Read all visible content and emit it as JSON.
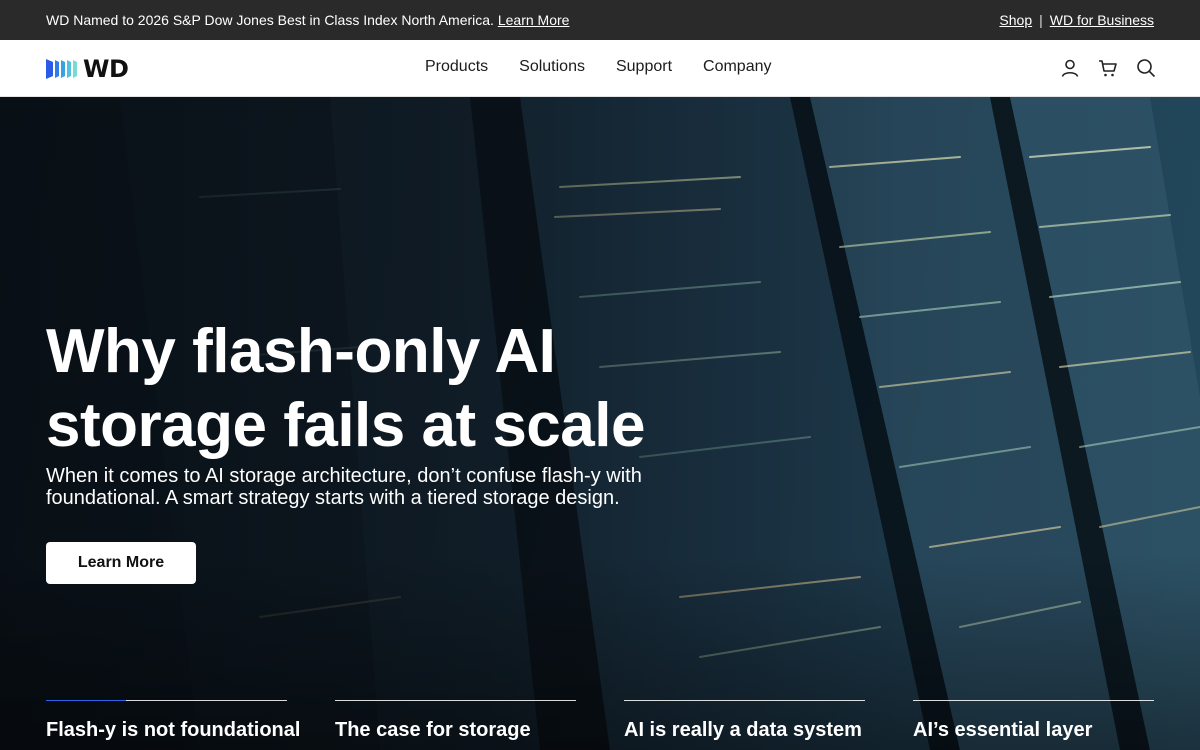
{
  "announcement": {
    "message": "WD Named to 2026 S&P Dow Jones Best in Class Index North America.",
    "link": "Learn More",
    "right_links": [
      "Shop",
      "WD for Business"
    ]
  },
  "header": {
    "logo_text": "WD",
    "nav": [
      "Products",
      "Solutions",
      "Support",
      "Company"
    ],
    "icons": [
      "account-icon",
      "cart-icon",
      "search-icon"
    ]
  },
  "hero": {
    "title_line1": "Why flash-only AI",
    "title_line2": "storage fails at scale",
    "subtitle_line1": "When it comes to AI storage architecture, don’t confuse flash-y with",
    "subtitle_line2": "foundational. A smart strategy starts with a tiered storage design.",
    "cta": "Learn More"
  },
  "cards": [
    {
      "label": "Flash-y is not foundational"
    },
    {
      "label": "The case for storage"
    },
    {
      "label": "AI is really a data system"
    },
    {
      "label": "AI’s essential layer"
    }
  ],
  "colors": {
    "topbar_bg": "#2a2a2a",
    "header_bg": "#ffffff",
    "accent": "#2e62e8",
    "logo_blue": "#2e62e8"
  }
}
